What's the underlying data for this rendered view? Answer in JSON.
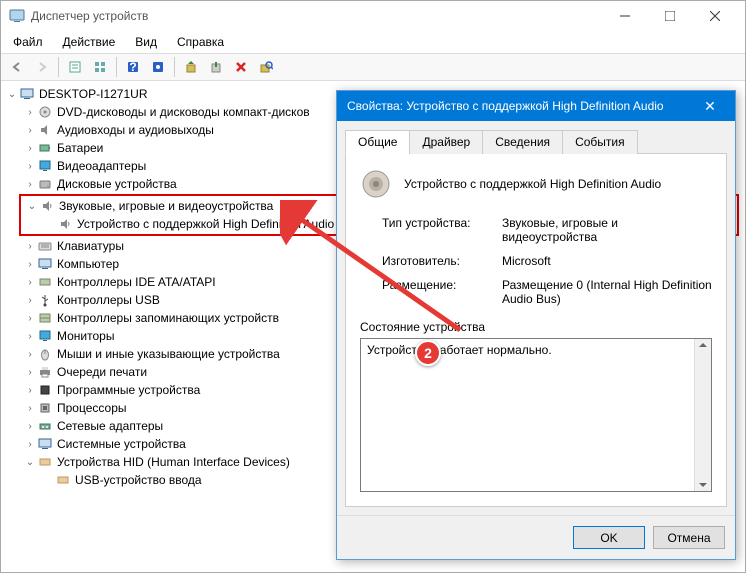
{
  "window": {
    "title": "Диспетчер устройств"
  },
  "menu": {
    "file": "Файл",
    "action": "Действие",
    "view": "Вид",
    "help": "Справка"
  },
  "tree": {
    "root": "DESKTOP-I1271UR",
    "dvd": "DVD-дисководы и дисководы компакт-дисков",
    "audio_io": "Аудиовходы и аудиовыходы",
    "batteries": "Батареи",
    "video": "Видеоадаптеры",
    "disks": "Дисковые устройства",
    "sound_cat": "Звуковые, игровые и видеоустройства",
    "sound_dev": "Устройство с поддержкой High Definition Audio",
    "keyboards": "Клавиатуры",
    "computer": "Компьютер",
    "ide": "Контроллеры IDE ATA/ATAPI",
    "usb_ctrl": "Контроллеры USB",
    "storage_ctrl": "Контроллеры запоминающих устройств",
    "monitors": "Мониторы",
    "mice": "Мыши и иные указывающие устройства",
    "print_q": "Очереди печати",
    "soft_dev": "Программные устройства",
    "cpu": "Процессоры",
    "net": "Сетевые адаптеры",
    "sys": "Системные устройства",
    "hid": "Устройства HID (Human Interface Devices)",
    "hid_child": "USB-устройство ввода"
  },
  "dialog": {
    "title": "Свойства: Устройство с поддержкой High Definition Audio",
    "tabs": {
      "general": "Общие",
      "driver": "Драйвер",
      "details": "Сведения",
      "events": "События"
    },
    "device_name": "Устройство с поддержкой High Definition Audio",
    "type_label": "Тип устройства:",
    "type_value": "Звуковые, игровые и видеоустройства",
    "mfr_label": "Изготовитель:",
    "mfr_value": "Microsoft",
    "loc_label": "Размещение:",
    "loc_value": "Размещение 0 (Internal High Definition Audio Bus)",
    "status_label": "Состояние устройства",
    "status_text": "Устройство работает нормально.",
    "ok": "OK",
    "cancel": "Отмена"
  },
  "badge": "2"
}
